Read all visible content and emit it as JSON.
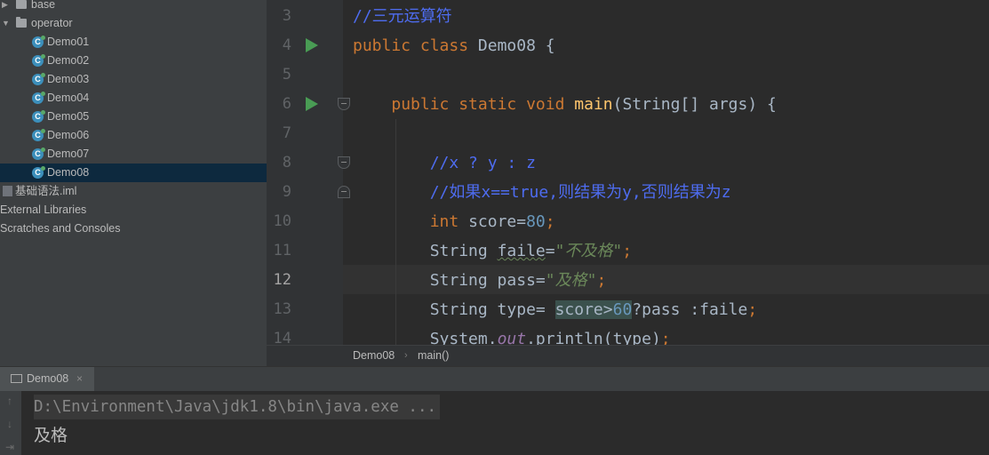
{
  "project_tree": {
    "rows": [
      {
        "label": "base",
        "type": "folder",
        "expanded": false
      },
      {
        "label": "operator",
        "type": "folder",
        "expanded": true
      },
      {
        "label": "Demo01",
        "type": "class"
      },
      {
        "label": "Demo02",
        "type": "class"
      },
      {
        "label": "Demo03",
        "type": "class"
      },
      {
        "label": "Demo04",
        "type": "class"
      },
      {
        "label": "Demo05",
        "type": "class"
      },
      {
        "label": "Demo06",
        "type": "class"
      },
      {
        "label": "Demo07",
        "type": "class"
      },
      {
        "label": "Demo08",
        "type": "class",
        "selected": true
      },
      {
        "label": "基础语法.iml",
        "type": "iml"
      },
      {
        "label": "External Libraries",
        "type": "root"
      },
      {
        "label": "Scratches and Consoles",
        "type": "root"
      }
    ]
  },
  "editor": {
    "current_line": "12",
    "lines": [
      {
        "num": "3",
        "run": false,
        "fold": "",
        "tokens": [
          {
            "c": "comment",
            "t": "//三元运算符"
          }
        ]
      },
      {
        "num": "4",
        "run": true,
        "fold": "",
        "tokens": [
          {
            "c": "kw",
            "t": "public class "
          },
          {
            "c": "plain",
            "t": "Demo08 {"
          }
        ]
      },
      {
        "num": "5",
        "run": false,
        "fold": "",
        "tokens": []
      },
      {
        "num": "6",
        "run": true,
        "fold": "start",
        "tokens": [
          {
            "c": "plain",
            "t": "    "
          },
          {
            "c": "kw",
            "t": "public static void "
          },
          {
            "c": "fn",
            "t": "main"
          },
          {
            "c": "plain",
            "t": "(String[] args) {"
          }
        ]
      },
      {
        "num": "7",
        "run": false,
        "fold": "",
        "tokens": []
      },
      {
        "num": "8",
        "run": false,
        "fold": "start",
        "tokens": [
          {
            "c": "plain",
            "t": "        "
          },
          {
            "c": "comment",
            "t": "//x ? y : z"
          }
        ]
      },
      {
        "num": "9",
        "run": false,
        "fold": "end",
        "tokens": [
          {
            "c": "plain",
            "t": "        "
          },
          {
            "c": "comment",
            "t": "//如果x==true,则结果为y,否则结果为z"
          }
        ]
      },
      {
        "num": "10",
        "run": false,
        "fold": "",
        "tokens": [
          {
            "c": "plain",
            "t": "        "
          },
          {
            "c": "kw",
            "t": "int "
          },
          {
            "c": "plain",
            "t": "score="
          },
          {
            "c": "num",
            "t": "80"
          },
          {
            "c": "kw",
            "t": ";"
          }
        ]
      },
      {
        "num": "11",
        "run": false,
        "fold": "",
        "tokens": [
          {
            "c": "plain",
            "t": "        String "
          },
          {
            "c": "plain typo",
            "t": "faile"
          },
          {
            "c": "plain",
            "t": "="
          },
          {
            "c": "str",
            "t": "\"不及格\""
          },
          {
            "c": "kw",
            "t": ";"
          }
        ]
      },
      {
        "num": "12",
        "run": false,
        "fold": "",
        "tokens": [
          {
            "c": "plain",
            "t": "        String pass="
          },
          {
            "c": "str",
            "t": "\"及格\""
          },
          {
            "c": "kw",
            "t": ";"
          }
        ]
      },
      {
        "num": "13",
        "run": false,
        "fold": "",
        "tokens": [
          {
            "c": "plain",
            "t": "        String type= "
          },
          {
            "c": "plain hl",
            "t": "score>"
          },
          {
            "c": "num hl",
            "t": "60"
          },
          {
            "c": "plain",
            "t": "?pass :faile"
          },
          {
            "c": "kw",
            "t": ";"
          }
        ]
      },
      {
        "num": "14",
        "run": false,
        "fold": "",
        "tokens": [
          {
            "c": "plain",
            "t": "        System."
          },
          {
            "c": "fld",
            "t": "out"
          },
          {
            "c": "plain",
            "t": ".println(type)"
          },
          {
            "c": "kw",
            "t": ";"
          }
        ]
      }
    ]
  },
  "breadcrumb": {
    "class_name": "Demo08",
    "method_name": "main()"
  },
  "run_panel": {
    "tab_label": "Demo08",
    "close_glyph": "×",
    "command_line": "D:\\Environment\\Java\\jdk1.8\\bin\\java.exe ...",
    "output_line": "及格"
  }
}
